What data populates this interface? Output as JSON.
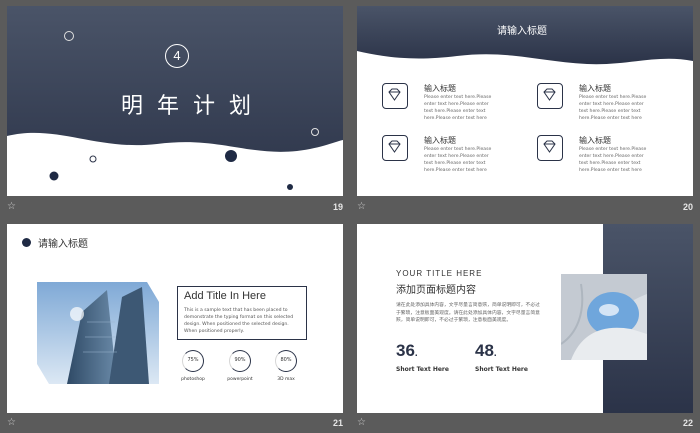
{
  "slides": [
    {
      "number": "19",
      "badge": "4",
      "title": "明年计划"
    },
    {
      "number": "20",
      "title": "请输入标题",
      "features": [
        {
          "icon": "diamond-icon",
          "title": "输入标题",
          "body": "Please enter text here.Please enter text here.Please enter text here.Please enter text here.Please enter text here"
        },
        {
          "icon": "diamond-icon",
          "title": "输入标题",
          "body": "Please enter text here.Please enter text here.Please enter text here.Please enter text here.Please enter text here"
        },
        {
          "icon": "diamond-icon",
          "title": "输入标题",
          "body": "Please enter text here.Please enter text here.Please enter text here.Please enter text here.Please enter text here"
        },
        {
          "icon": "diamond-icon",
          "title": "输入标题",
          "body": "Please enter text here.Please enter text here.Please enter text here.Please enter text here.Please enter text here"
        }
      ]
    },
    {
      "number": "21",
      "title": "请输入标题",
      "box_title": "Add Title In Here",
      "box_body": "This is a sample text that has been placed to demonstrate the typing format on this selected design. When positioned the selected design. When positioned properly.",
      "gauges": [
        {
          "value": "75%",
          "label": "photoshop",
          "level": 0.75
        },
        {
          "value": "90%",
          "label": "powerpoint",
          "level": 0.9
        },
        {
          "value": "80%",
          "label": "3D max",
          "level": 0.8
        }
      ]
    },
    {
      "number": "22",
      "eyebrow": "YOUR TITLE HERE",
      "heading": "添加页面标题内容",
      "body": "请在此处添加具体内容，文字尽量言简意赅，简单说明即可，不必过于繁琐，注意板面美观度。请在此处添加具体内容，文字尽量言简意赅，简单说明即可，不必过于繁琐，注意板面美观度。",
      "stats": [
        {
          "value": "36",
          "suffix": ".",
          "label": "Short Text Here"
        },
        {
          "value": "48",
          "suffix": ".",
          "label": "Short Text Here"
        }
      ]
    }
  ],
  "colors": {
    "navy": "#2b3348",
    "accent": "#1f2a44",
    "background": "#5b5b5b"
  }
}
